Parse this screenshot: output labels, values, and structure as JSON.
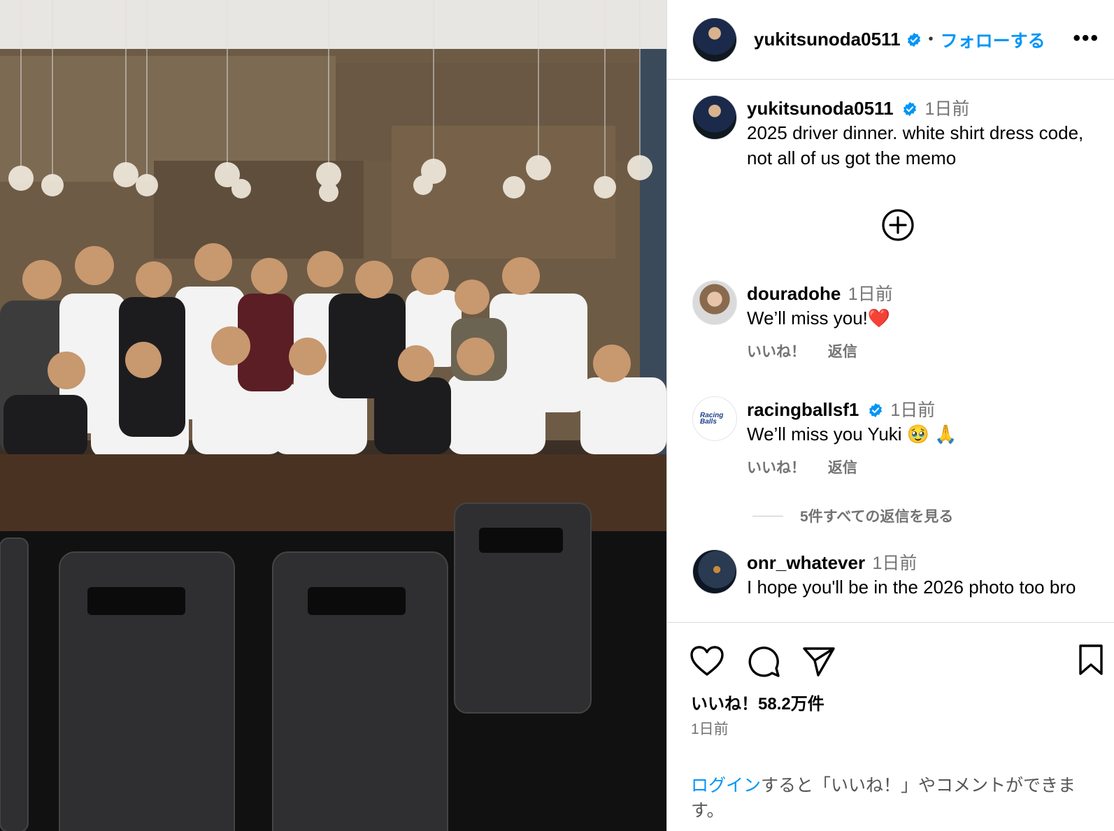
{
  "post": {
    "username": "yukitsunoda0511",
    "follow_label": "フォローする",
    "separator": "•",
    "more_label": "•••",
    "caption_time": "1日前",
    "caption": "2025 driver dinner. white shirt dress code, not all of us got the memo",
    "photo_alt": "Group photo of drivers at dinner"
  },
  "comments": [
    {
      "username": "douradohe",
      "time": "1日前",
      "text": "We’ll miss you!❤️",
      "like": "いいね！",
      "reply": "返信",
      "verified": false
    },
    {
      "username": "racingballsf1",
      "time": "1日前",
      "text": "We’ll miss you Yuki 🥹 🙏",
      "like": "いいね！",
      "reply": "返信",
      "verified": true,
      "avatar_text": "Racing Balls"
    },
    {
      "username": "onr_whatever",
      "time": "1日前",
      "text": "I hope you'll be in the 2026 photo too bro",
      "verified": false
    }
  ],
  "view_replies": "5件すべての返信を見る",
  "footer": {
    "likes": "いいね！58.2万件",
    "date": "1日前",
    "login_link": "ログイン",
    "login_rest": "すると「いいね！」やコメントができます。"
  },
  "colors": {
    "accent": "#0095f6",
    "muted": "#737373",
    "border": "#dbdbdb"
  },
  "icons": [
    "heart-icon",
    "comment-icon",
    "share-icon",
    "bookmark-icon",
    "add-circle-icon",
    "verified-badge-icon",
    "more-icon"
  ]
}
